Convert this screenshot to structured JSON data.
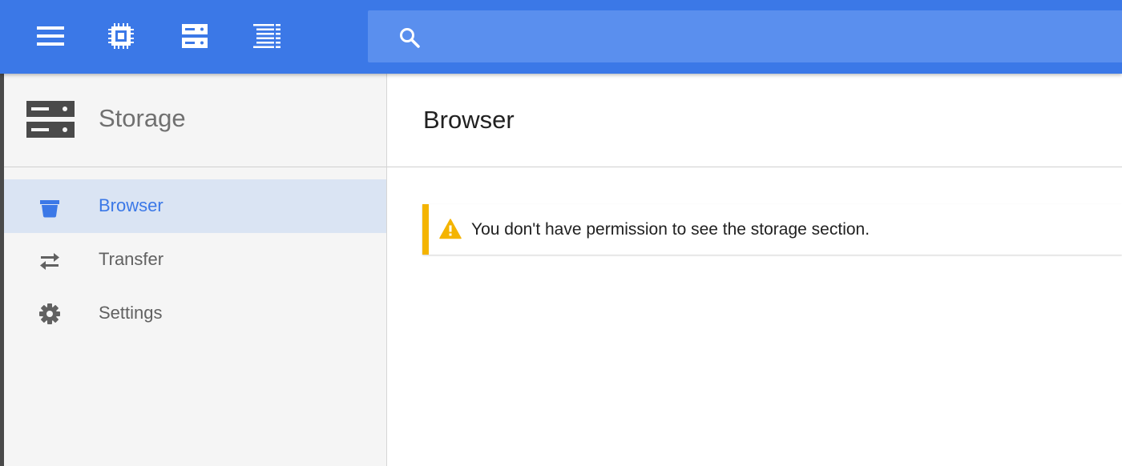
{
  "topbar": {
    "icons": [
      "menu-icon",
      "compute-chip-icon",
      "storage-icon",
      "logging-icon"
    ],
    "search": {
      "icon": "search-icon",
      "placeholder": "",
      "value": ""
    },
    "color": "#3b78e7"
  },
  "sidebar": {
    "header": {
      "icon": "storage-icon",
      "title": "Storage"
    },
    "items": [
      {
        "label": "Browser",
        "icon": "bucket-icon",
        "active": true
      },
      {
        "label": "Transfer",
        "icon": "swap-arrows-icon",
        "active": false
      },
      {
        "label": "Settings",
        "icon": "gear-icon",
        "active": false
      }
    ]
  },
  "main": {
    "title": "Browser",
    "alert": {
      "icon": "warning-icon",
      "text": "You don't have permission to see the storage section.",
      "color": "#f4b400"
    }
  }
}
